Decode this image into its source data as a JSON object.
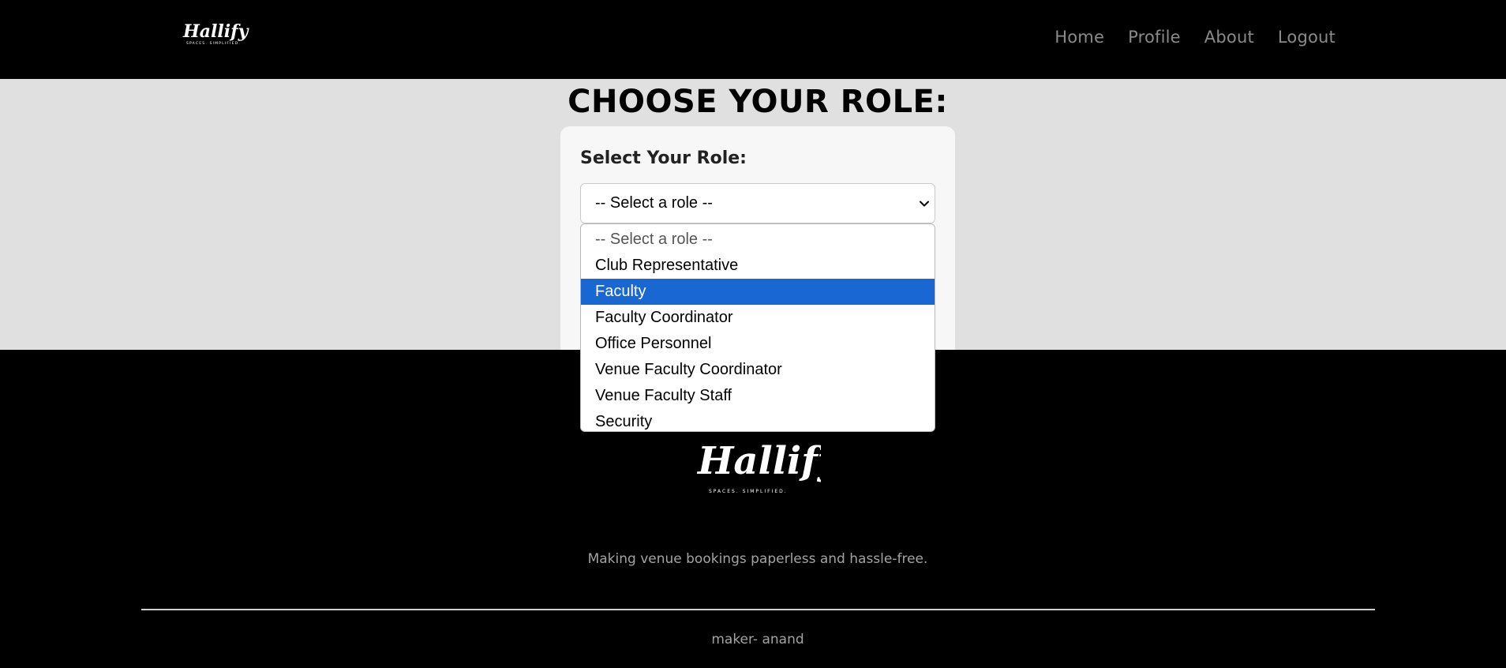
{
  "header": {
    "logo_text": "Hallify",
    "logo_tagline": "SPACES. SIMPLIFIED.",
    "nav": [
      {
        "label": "Home"
      },
      {
        "label": "Profile"
      },
      {
        "label": "About"
      },
      {
        "label": "Logout"
      }
    ]
  },
  "main": {
    "title": "CHOOSE YOUR ROLE:",
    "card": {
      "label": "Select Your Role:",
      "select_value": "-- Select a role --",
      "options": [
        "-- Select a role --",
        "Club Representative",
        "Faculty",
        "Faculty Coordinator",
        "Office Personnel",
        "Venue Faculty Coordinator",
        "Venue Faculty Staff",
        "Security"
      ],
      "highlighted_option": "Faculty",
      "highlight_color": "#1967d2"
    }
  },
  "footer": {
    "logo_text": "Hallify",
    "logo_tagline": "SPACES. SIMPLIFIED.",
    "tagline": "Making venue bookings paperless and hassle-free.",
    "maker": "maker- anand"
  }
}
